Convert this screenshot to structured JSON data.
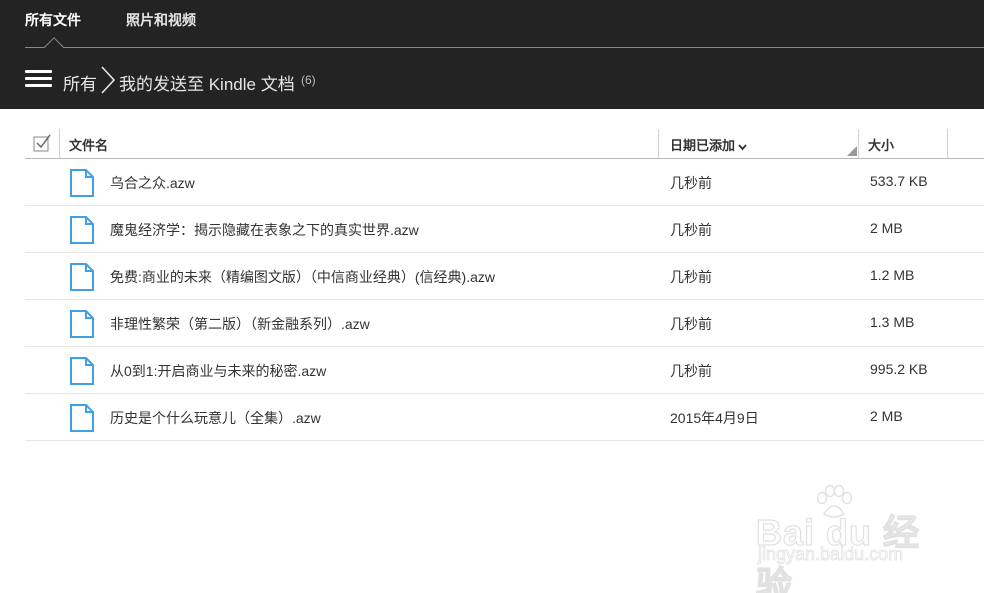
{
  "nav": {
    "tabs": [
      {
        "label": "所有文件",
        "active": true
      },
      {
        "label": "照片和视频",
        "active": false
      }
    ]
  },
  "breadcrumb": {
    "root": "所有",
    "current": "我的发送至 Kindle 文档",
    "count": "(6)"
  },
  "table": {
    "columns": {
      "name": "文件名",
      "date": "日期已添加",
      "size": "大小"
    },
    "sort_column": "date",
    "sort_direction": "descending",
    "rows": [
      {
        "name": "乌合之众.azw",
        "date": "几秒前",
        "size": "533.7 KB"
      },
      {
        "name": "魔鬼经济学：揭示隐藏在表象之下的真实世界.azw",
        "date": "几秒前",
        "size": "2 MB"
      },
      {
        "name": "免费:商业的未来（精编图文版）（中信商业经典）(信经典).azw",
        "date": "几秒前",
        "size": "1.2 MB"
      },
      {
        "name": "非理性繁荣（第二版）（新金融系列）.azw",
        "date": "几秒前",
        "size": "1.3 MB"
      },
      {
        "name": "从0到1:开启商业与未来的秘密.azw",
        "date": "几秒前",
        "size": "995.2 KB"
      },
      {
        "name": "历史是个什么玩意儿（全集）.azw",
        "date": "2015年4月9日",
        "size": "2 MB"
      }
    ]
  },
  "watermark": {
    "brand": "Bai du 经验",
    "url": "jingyan.baidu.com"
  },
  "colors": {
    "topbar": "#232323",
    "file_icon": "#3fa0e6",
    "text": "#333333"
  },
  "icons": {
    "menu": "hamburger-icon",
    "breadcrumb_separator": "chevron-right-icon",
    "select_all": "checkbox-icon",
    "sort": "chevron-down-icon",
    "file": "document-icon"
  }
}
